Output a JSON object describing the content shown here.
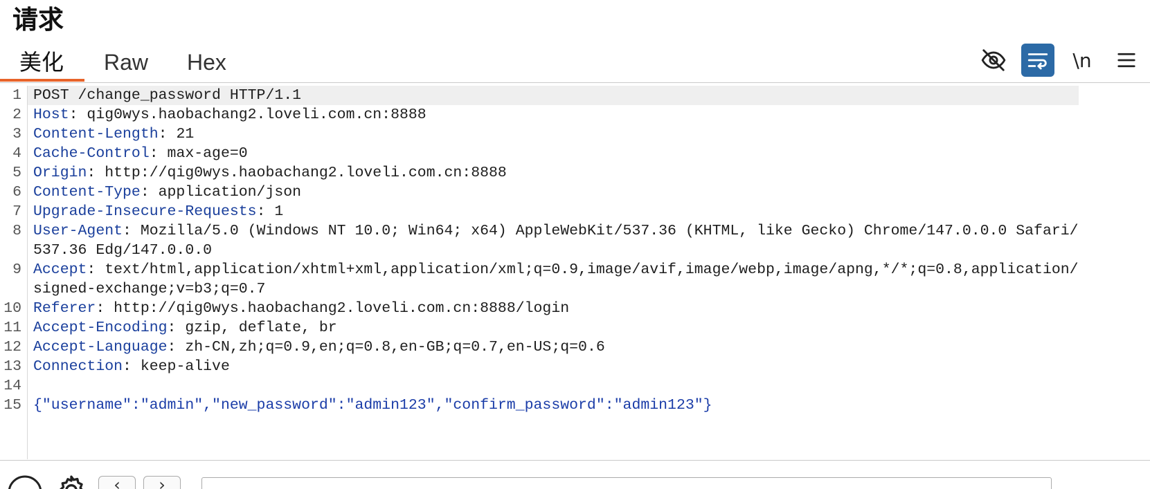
{
  "panel": {
    "title": "请求"
  },
  "tabs": [
    {
      "label": "美化",
      "active": true
    },
    {
      "label": "Raw",
      "active": false
    },
    {
      "label": "Hex",
      "active": false
    }
  ],
  "toolbar": {
    "newline_label": "\\n",
    "icons": [
      "eye-off-icon",
      "wrap-lines-icon",
      "newline-toggle",
      "hamburger-menu-icon"
    ],
    "accent_color": "#2c6aa6"
  },
  "editor": {
    "lines": [
      {
        "no": "1",
        "name": "",
        "value": "POST /change_password HTTP/1.1"
      },
      {
        "no": "2",
        "name": "Host",
        "value": ": qig0wys.haobachang2.loveli.com.cn:8888"
      },
      {
        "no": "3",
        "name": "Content-Length",
        "value": ": 21"
      },
      {
        "no": "4",
        "name": "Cache-Control",
        "value": ": max-age=0"
      },
      {
        "no": "5",
        "name": "Origin",
        "value": ": http://qig0wys.haobachang2.loveli.com.cn:8888"
      },
      {
        "no": "6",
        "name": "Content-Type",
        "value": ": application/json"
      },
      {
        "no": "7",
        "name": "Upgrade-Insecure-Requests",
        "value": ": 1"
      },
      {
        "no": "8",
        "name": "User-Agent",
        "value": ": Mozilla/5.0 (Windows NT 10.0; Win64; x64) AppleWebKit/537.36 (KHTML, like Gecko) Chrome/147.0.0.0 Safari/537.36 Edg/147.0.0.0"
      },
      {
        "no": "9",
        "name": "Accept",
        "value": ": text/html,application/xhtml+xml,application/xml;q=0.9,image/avif,image/webp,image/apng,*/*;q=0.8,application/signed-exchange;v=b3;q=0.7"
      },
      {
        "no": "10",
        "name": "Referer",
        "value": ": http://qig0wys.haobachang2.loveli.com.cn:8888/login"
      },
      {
        "no": "11",
        "name": "Accept-Encoding",
        "value": ": gzip, deflate, br"
      },
      {
        "no": "12",
        "name": "Accept-Language",
        "value": ": zh-CN,zh;q=0.9,en;q=0.8,en-GB;q=0.7,en-US;q=0.6"
      },
      {
        "no": "13",
        "name": "Connection",
        "value": ": keep-alive"
      },
      {
        "no": "14",
        "name": "",
        "value": ""
      },
      {
        "no": "15",
        "name": "",
        "value": "{\"username\":\"admin\",\"new_password\":\"admin123\",\"confirm_password\":\"admin123\"}"
      }
    ]
  }
}
